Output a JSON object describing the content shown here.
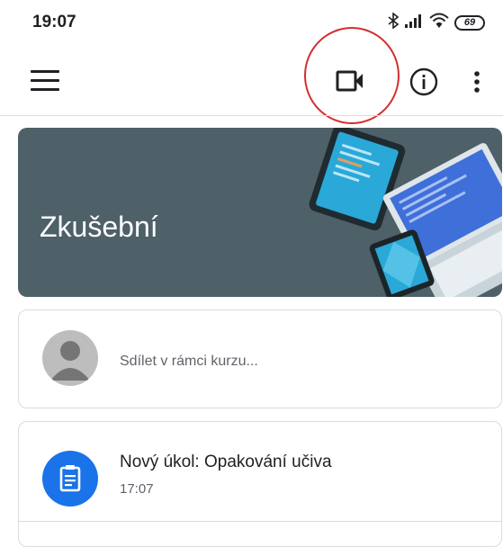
{
  "status_bar": {
    "time": "19:07",
    "battery": "69",
    "icons": [
      "bluetooth-icon",
      "signal-icon",
      "wifi-icon",
      "battery-icon"
    ]
  },
  "app_bar": {
    "icons": [
      "menu-icon",
      "video-camera-icon",
      "info-icon",
      "more-vert-icon"
    ]
  },
  "class_banner": {
    "title": "Zkušební",
    "background_color": "#4e6068"
  },
  "share_box": {
    "placeholder": "Sdílet v rámci kurzu..."
  },
  "posts": [
    {
      "title": "Nový úkol: Opakování učiva",
      "time": "17:07",
      "icon": "assignment-icon",
      "icon_color": "#1a73e8"
    }
  ],
  "highlight_color": "#d32f2f"
}
